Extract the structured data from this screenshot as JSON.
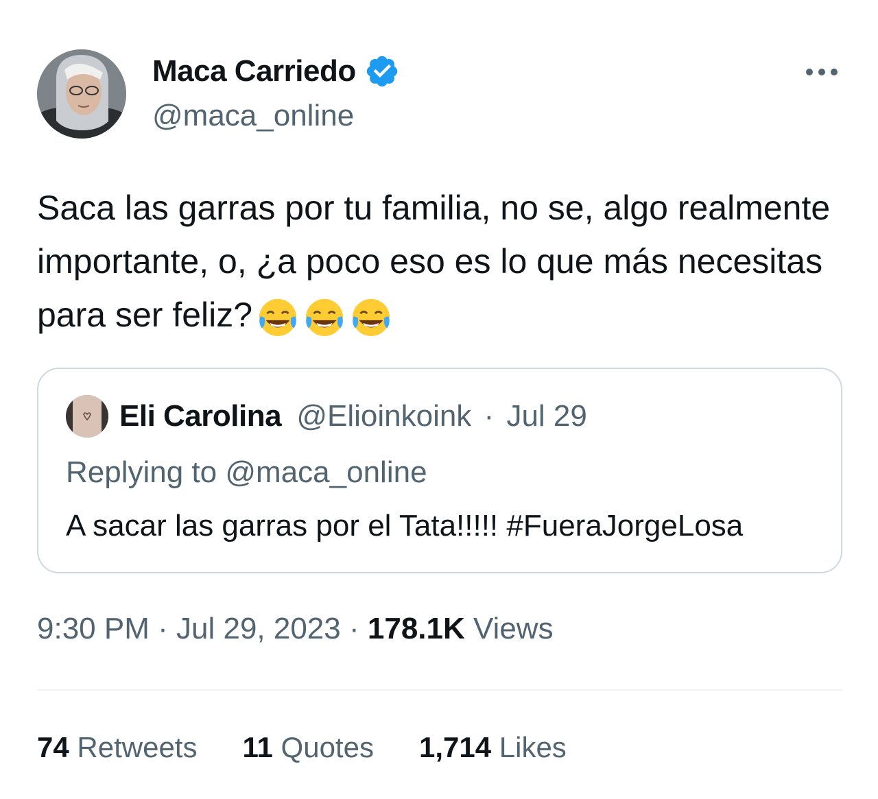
{
  "author": {
    "name": "Maca Carriedo",
    "handle": "@maca_online",
    "verified": true
  },
  "tweet": {
    "text": "Saca las garras por tu familia, no se, algo realmente importante, o, ¿a poco eso es lo que más necesitas para ser feliz?",
    "emoji_name": "face-with-tears-of-joy",
    "emoji_count": 3
  },
  "quoted_tweet": {
    "name": "Eli Carolina",
    "handle": "@Elioinkoink",
    "separator": "·",
    "date": "Jul 29",
    "replying_prefix": "Replying to",
    "replying_handle": "@maca_online",
    "text": "A sacar las garras por el Tata!!!!! #FueraJorgeLosa"
  },
  "meta": {
    "time": "9:30 PM",
    "separator": "·",
    "date": "Jul 29, 2023",
    "views_count": "178.1K",
    "views_label": "Views"
  },
  "stats": {
    "retweets_count": "74",
    "retweets_label": "Retweets",
    "quotes_count": "11",
    "quotes_label": "Quotes",
    "likes_count": "1,714",
    "likes_label": "Likes"
  },
  "colors": {
    "primary_text": "#0f1419",
    "secondary_text": "#536471",
    "verified_blue": "#1d9bf0",
    "border": "#cfd9de",
    "divider": "#eff3f4"
  },
  "icons": {
    "verified": "verified-badge-icon",
    "more": "more-options-icon",
    "emoji": "face-with-tears-of-joy-icon"
  }
}
